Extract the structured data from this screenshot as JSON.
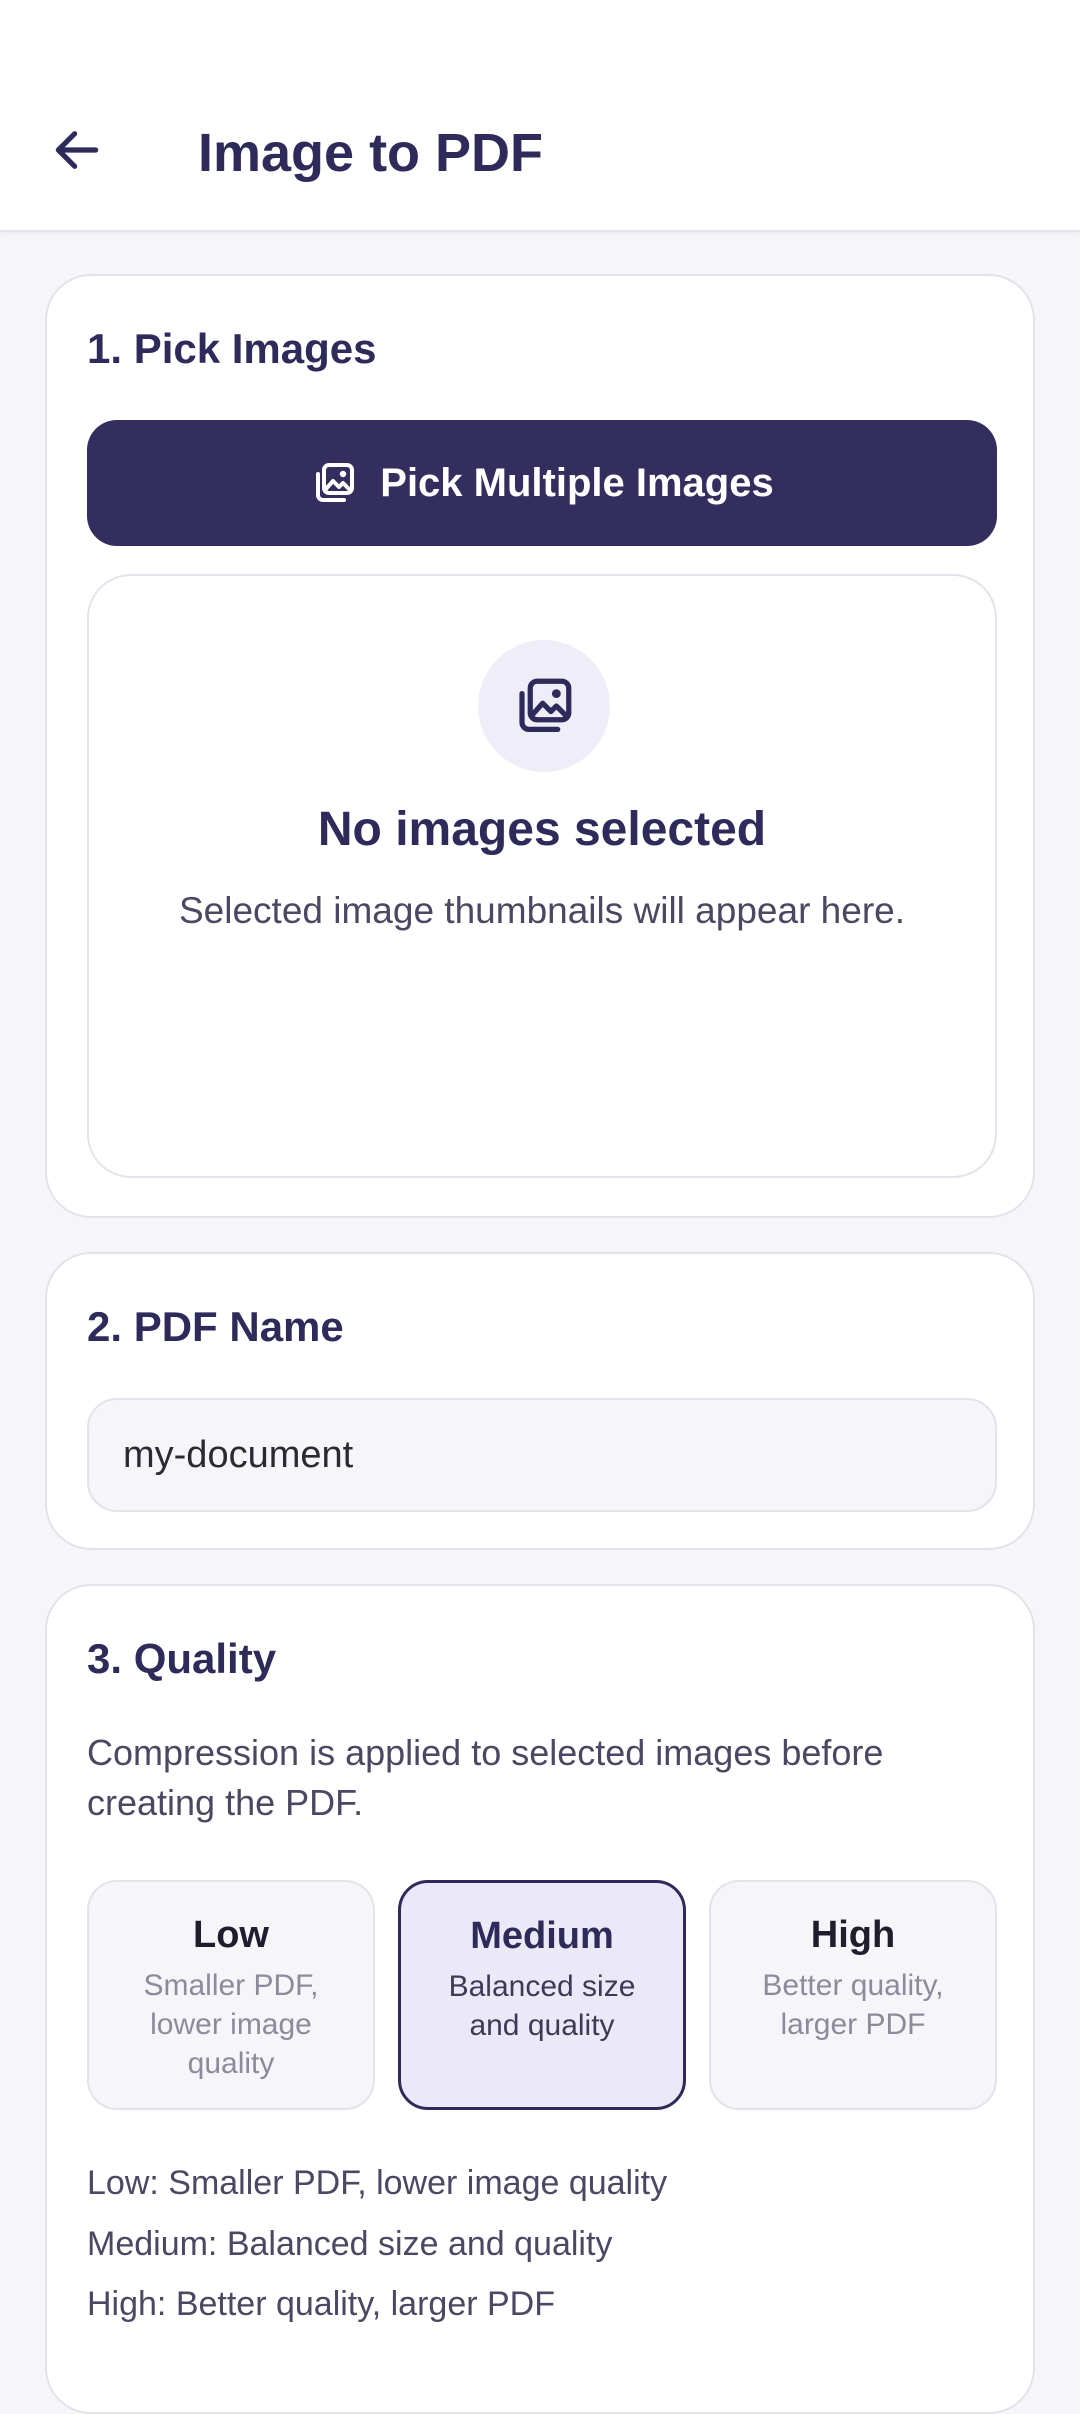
{
  "appbar": {
    "title": "Image to PDF"
  },
  "pick_section": {
    "title": "1. Pick Images",
    "button_label": "Pick Multiple Images",
    "empty_title": "No images selected",
    "empty_subtitle": "Selected image thumbnails will appear here."
  },
  "name_section": {
    "title": "2. PDF Name",
    "value": "my-document"
  },
  "quality_section": {
    "title": "3. Quality",
    "description": "Compression is applied to selected images before creating the PDF.",
    "selected": "Medium",
    "options": [
      {
        "name": "Low",
        "desc": "Smaller PDF, lower image quality"
      },
      {
        "name": "Medium",
        "desc": "Balanced size and quality"
      },
      {
        "name": "High",
        "desc": "Better quality, larger PDF"
      }
    ],
    "legend": [
      "Low: Smaller PDF, lower image quality",
      "Medium: Balanced size and quality",
      "High: Better quality, larger PDF"
    ]
  },
  "colors": {
    "primary": "#332e5d",
    "surface": "#ffffff",
    "background": "#f6f5fa",
    "selected_bg": "#ebe9f7",
    "border": "#e4e2ea"
  }
}
